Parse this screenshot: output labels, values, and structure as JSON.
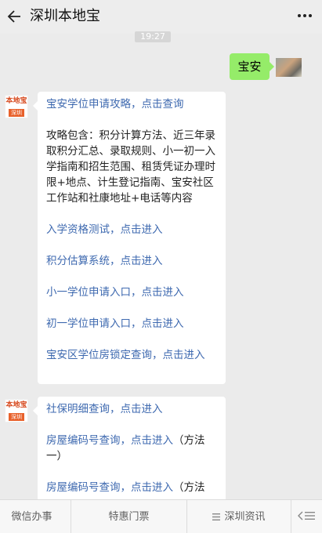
{
  "header": {
    "title": "深圳本地宝",
    "back_icon": "arrow-left-icon",
    "more_icon": "more-dots-icon"
  },
  "chat": {
    "timestamp": "19:27",
    "user_message": "宝安",
    "official_logo": {
      "top": "本地宝",
      "bottom": "深圳"
    },
    "reply1": {
      "link_title": "宝安学位申请攻略，点击查询",
      "description": "攻略包含：积分计算方法、近三年录取积分汇总、录取规则、小一初一入学指南和招生范围、租赁凭证办理时限+地点、计生登记指南、宝安社区工作站和社康地址+电话等内容",
      "links": [
        "入学资格测试，点击进入",
        "积分估算系统，点击进入",
        "小一学位申请入口，点击进入",
        "初一学位申请入口，点击进入",
        "宝安区学位房锁定查询，点击进入"
      ]
    },
    "reply2": {
      "line1": "社保明细查询，点击进入",
      "line2_link": "房屋编码号查询，点击进入",
      "line2_suffix": "（方法一）",
      "line3_link": "房屋编码号查询，点击进入",
      "line3_suffix": "（方法"
    }
  },
  "bottom_menu": {
    "items": [
      "微信办事",
      "特惠门票",
      "深圳资讯"
    ],
    "keyboard_icon": "keyboard-toggle-icon",
    "menu_icon": "menu-lines-icon"
  },
  "colors": {
    "link": "#3f6ab0",
    "user_bubble": "#95ec69",
    "background": "#ebebeb"
  }
}
